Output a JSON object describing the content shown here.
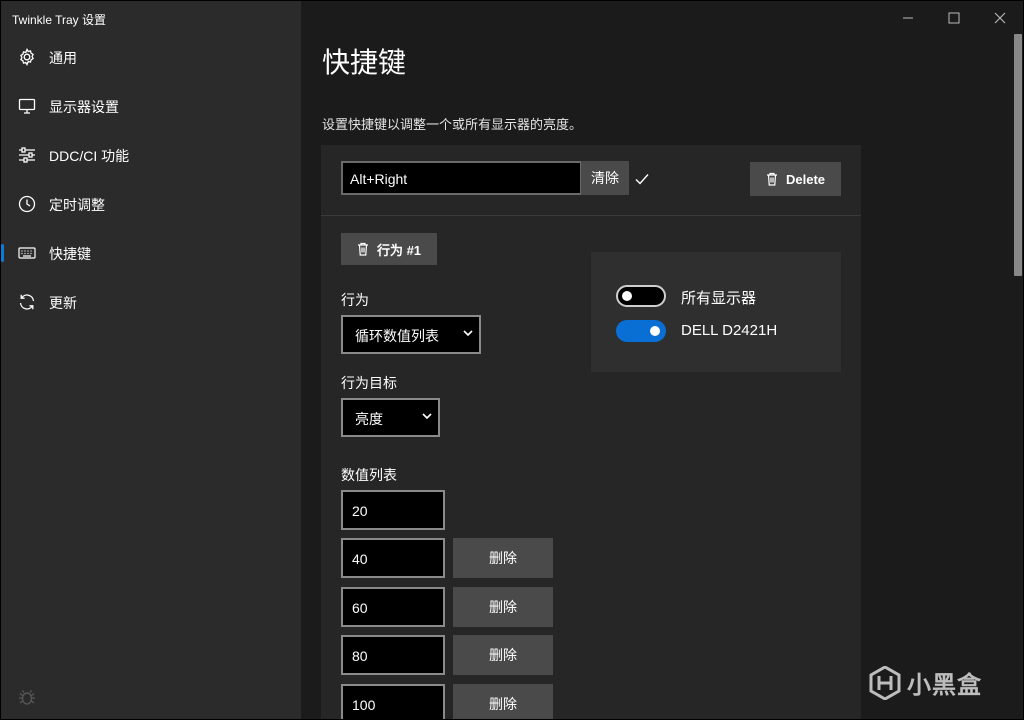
{
  "window": {
    "title": "Twinkle Tray 设置"
  },
  "sidebar": {
    "items": [
      {
        "label": "通用",
        "icon": "gear-icon"
      },
      {
        "label": "显示器设置",
        "icon": "monitor-icon"
      },
      {
        "label": "DDC/CI 功能",
        "icon": "sliders-icon"
      },
      {
        "label": "定时调整",
        "icon": "clock-icon"
      },
      {
        "label": "快捷键",
        "icon": "keyboard-icon",
        "active": true
      },
      {
        "label": "更新",
        "icon": "refresh-icon"
      }
    ]
  },
  "page": {
    "title": "快捷键",
    "subtitle": "设置快捷键以调整一个或所有显示器的亮度。"
  },
  "hotkey": {
    "value": "Alt+Right",
    "clear_label": "清除",
    "delete_label": "Delete"
  },
  "action": {
    "button_label": "行为 #1",
    "behavior_label": "行为",
    "behavior_value": "循环数值列表",
    "target_label": "行为目标",
    "target_value": "亮度",
    "list_label": "数值列表",
    "values": [
      "20",
      "40",
      "60",
      "80",
      "100"
    ],
    "remove_label": "删除"
  },
  "monitors": [
    {
      "label": "所有显示器",
      "enabled": false
    },
    {
      "label": "DELL D2421H",
      "enabled": true
    }
  ],
  "watermark": {
    "text": "小黑盒"
  },
  "colors": {
    "accent": "#0a7cd8",
    "sidebar_bg": "#2b2b2b",
    "content_bg": "#1b1b1b",
    "card_bg": "#262626"
  }
}
